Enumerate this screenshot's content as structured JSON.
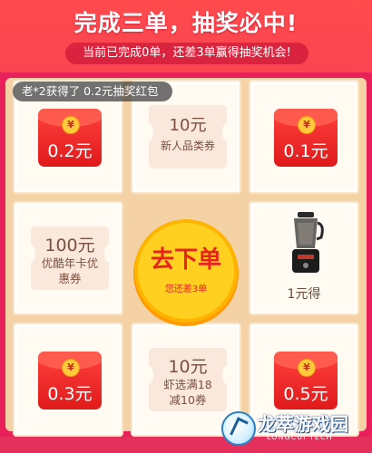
{
  "header": {
    "title": "完成三单，抽奖必中!",
    "subtitle": "当前已完成0单，还差3单赢得抽奖机会!"
  },
  "toast": {
    "text": "老*2获得了 0.2元抽奖红包"
  },
  "grid": {
    "cell_1": {
      "type": "red-envelope",
      "icon": "yen-coin-icon",
      "coin": "¥",
      "amount": "0.2元"
    },
    "cell_2": {
      "type": "coupon",
      "value": "10元",
      "desc": "新人品类券"
    },
    "cell_3": {
      "type": "red-envelope",
      "icon": "yen-coin-icon",
      "coin": "¥",
      "amount": "0.1元"
    },
    "cell_4": {
      "type": "coupon",
      "value": "100元",
      "desc": "优酷年卡优惠券"
    },
    "center": {
      "label": "去下单",
      "sub": "您还差3单"
    },
    "cell_6": {
      "type": "product",
      "icon": "blender-icon",
      "text": "1元得"
    },
    "cell_7": {
      "type": "red-envelope",
      "icon": "yen-coin-icon",
      "coin": "¥",
      "amount": "0.3元"
    },
    "cell_8": {
      "type": "coupon",
      "value": "10元",
      "desc": "虾选满18减10券"
    },
    "cell_9": {
      "type": "red-envelope",
      "icon": "yen-coin-icon",
      "coin": "¥",
      "amount": "0.5元"
    }
  },
  "watermark": {
    "name": "龙萃游戏园",
    "sub": "LONGCUI TECH"
  },
  "colors": {
    "background": "#f2385a",
    "button": "#ffd01f",
    "envelope": "#e01a1a",
    "coupon": "#fbe8dc"
  }
}
